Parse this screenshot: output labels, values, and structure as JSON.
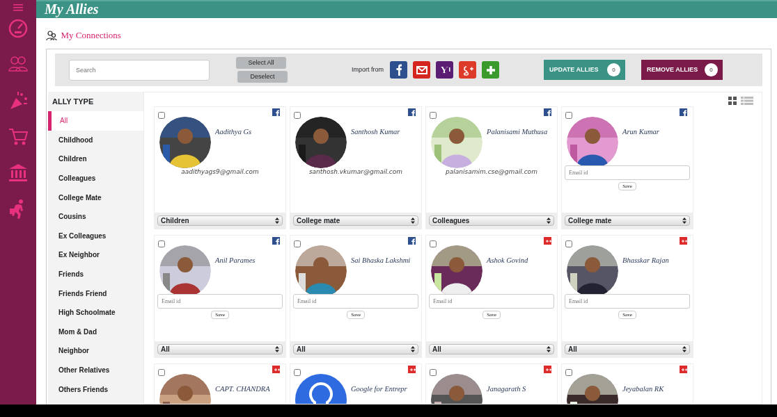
{
  "header": {
    "title": "My Allies"
  },
  "sidebar": {
    "items": [
      {
        "kind": "dashboard"
      },
      {
        "kind": "people"
      },
      {
        "kind": "party"
      },
      {
        "kind": "cart"
      },
      {
        "kind": "bank"
      },
      {
        "kind": "walker"
      }
    ]
  },
  "page_title": "My Connections",
  "toolbar": {
    "search": {
      "placeholder": "Search"
    },
    "select_all": "Select All",
    "deselect": "Deselect",
    "import_label": "Import from",
    "import_sources": [
      {
        "kind": "facebook"
      },
      {
        "kind": "mail"
      },
      {
        "kind": "yahoo"
      },
      {
        "kind": "google"
      },
      {
        "kind": "add"
      }
    ],
    "update_button": {
      "label": "UPDATE ALLIES",
      "count": "0"
    },
    "remove_button": {
      "label": "REMOVE ALLIES",
      "count": "0"
    }
  },
  "ally_types": {
    "title": "ALLY TYPE",
    "items": [
      {
        "label": "All",
        "selected": true
      },
      {
        "label": "Childhood",
        "selected": false
      },
      {
        "label": "Children",
        "selected": false
      },
      {
        "label": "Colleagues",
        "selected": false
      },
      {
        "label": "College Mate",
        "selected": false
      },
      {
        "label": "Cousins",
        "selected": false
      },
      {
        "label": "Ex Colleagues",
        "selected": false
      },
      {
        "label": "Ex Neighbor",
        "selected": false
      },
      {
        "label": "Friends",
        "selected": false
      },
      {
        "label": "Friends Friend",
        "selected": false
      },
      {
        "label": "High Schoolmate",
        "selected": false
      },
      {
        "label": "Mom & Dad",
        "selected": false
      },
      {
        "label": "Neighbor",
        "selected": false
      },
      {
        "label": "Other Relatives",
        "selected": false
      },
      {
        "label": "Others Friends",
        "selected": false
      }
    ]
  },
  "views": [
    {
      "kind": "grid",
      "selected": true
    },
    {
      "kind": "list",
      "selected": false
    }
  ],
  "contacts": [
    {
      "name": "Aadithya Gs",
      "source": {
        "kind": "facebook"
      },
      "checked": false,
      "email": "aadithyags9@gmail.com",
      "category": "Children"
    },
    {
      "name": "Santhosh Kumar",
      "source": {
        "kind": "facebook"
      },
      "checked": false,
      "email": "santhosh.vkumar@gmail.com",
      "category": "College mate"
    },
    {
      "name": "Palanisami Muthusa",
      "source": {
        "kind": "facebook"
      },
      "checked": false,
      "email": "palanisamim.cse@gmail.com",
      "category": "Colleagues"
    },
    {
      "name": "Arun Kumar",
      "source": {
        "kind": "facebook"
      },
      "checked": false,
      "placeholder": "Email id",
      "save": "Save",
      "category": "College mate"
    },
    {
      "name": "Anil Parames",
      "source": {
        "kind": "facebook"
      },
      "checked": false,
      "placeholder": "Email id",
      "save": "Save",
      "category": "All"
    },
    {
      "name": "Sai Bhaska Lakshmi",
      "source": {
        "kind": "facebook"
      },
      "checked": false,
      "placeholder": "Email id",
      "save": "Save",
      "category": "All"
    },
    {
      "name": "Ashok Govind",
      "source": {
        "kind": "google"
      },
      "checked": false,
      "placeholder": "Email id",
      "save": "Save",
      "category": "All"
    },
    {
      "name": "Bhasskar Rajan",
      "source": {
        "kind": "google"
      },
      "checked": false,
      "placeholder": "Email id",
      "save": "Save",
      "category": "All"
    },
    {
      "name": "CAPT. CHANDRA",
      "source": {
        "kind": "google"
      },
      "checked": false
    },
    {
      "name": "Google for Entrepr",
      "source": {
        "kind": "google"
      },
      "checked": false,
      "avatar": {
        "kind": "bulb"
      }
    },
    {
      "name": "Janagarath S",
      "source": {
        "kind": "google"
      },
      "checked": false
    },
    {
      "name": "Jeyabalan RK",
      "source": {
        "kind": "google"
      },
      "checked": false
    }
  ]
}
